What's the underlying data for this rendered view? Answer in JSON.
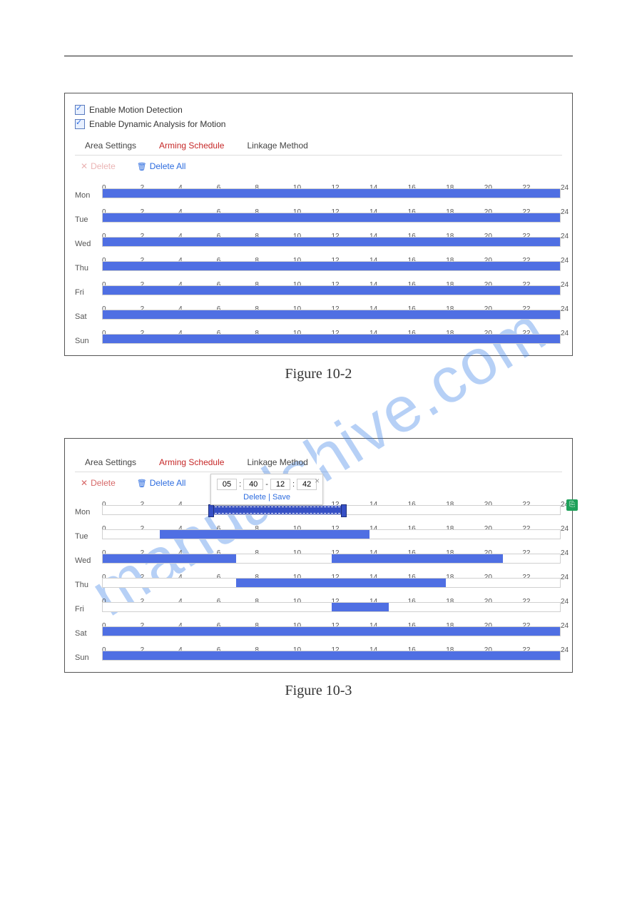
{
  "watermark": "manualshive.com",
  "captions": {
    "fig1": "Figure 10-2",
    "fig2": "Figure 10-3"
  },
  "checkboxes": {
    "enable_motion": "Enable Motion Detection",
    "enable_dynamic": "Enable Dynamic Analysis for Motion"
  },
  "tabs": {
    "area": "Area Settings",
    "arming": "Arming Schedule",
    "linkage": "Linkage Method"
  },
  "buttons": {
    "delete": "Delete",
    "delete_all": "Delete All"
  },
  "ticks": [
    "0",
    "2",
    "4",
    "6",
    "8",
    "10",
    "12",
    "14",
    "16",
    "18",
    "20",
    "22",
    "24"
  ],
  "days": [
    "Mon",
    "Tue",
    "Wed",
    "Thu",
    "Fri",
    "Sat",
    "Sun"
  ],
  "fig1_schedule": {
    "Mon": [
      {
        "start": 0,
        "end": 24
      }
    ],
    "Tue": [
      {
        "start": 0,
        "end": 24
      }
    ],
    "Wed": [
      {
        "start": 0,
        "end": 24
      }
    ],
    "Thu": [
      {
        "start": 0,
        "end": 24
      }
    ],
    "Fri": [
      {
        "start": 0,
        "end": 24
      }
    ],
    "Sat": [
      {
        "start": 0,
        "end": 24
      }
    ],
    "Sun": [
      {
        "start": 0,
        "end": 24
      }
    ]
  },
  "fig2_schedule": {
    "Mon": [
      {
        "start": 5.67,
        "end": 12.7,
        "selected": true
      }
    ],
    "Tue": [
      {
        "start": 3,
        "end": 14
      }
    ],
    "Wed": [
      {
        "start": 0,
        "end": 7
      },
      {
        "start": 12,
        "end": 21
      }
    ],
    "Thu": [
      {
        "start": 7,
        "end": 18
      }
    ],
    "Fri": [
      {
        "start": 12,
        "end": 15
      }
    ],
    "Sat": [
      {
        "start": 0,
        "end": 24
      }
    ],
    "Sun": [
      {
        "start": 0,
        "end": 24
      }
    ]
  },
  "popup": {
    "h1": "05",
    "m1": "40",
    "h2": "12",
    "m2": "42",
    "sep1": ":",
    "dash": "-",
    "sep2": ":",
    "delete": "Delete",
    "save": "Save",
    "bar": "|"
  }
}
